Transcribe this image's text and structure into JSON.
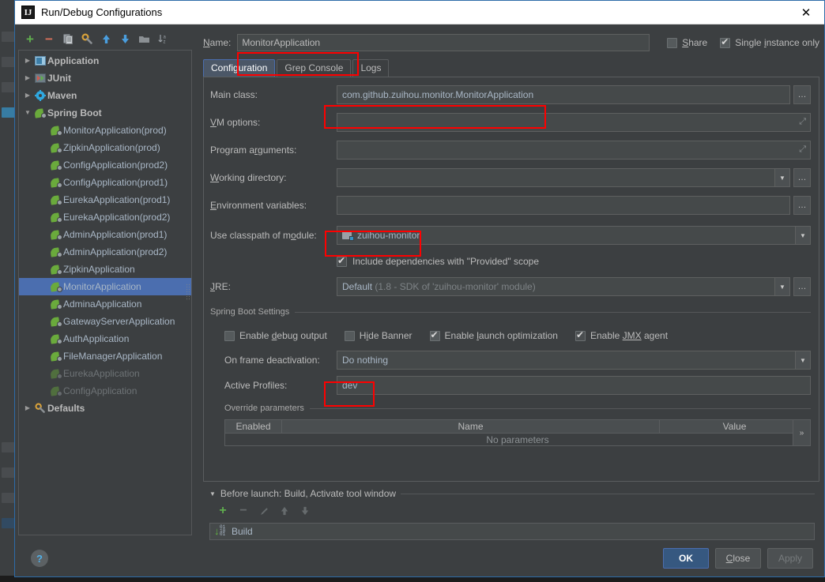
{
  "window": {
    "title": "Run/Debug Configurations",
    "icon": "intellij-idea-icon",
    "close_label": "✕"
  },
  "tree_toolbar": [
    {
      "name": "add-configuration-button",
      "glyph": "+",
      "color": "#5fad4e"
    },
    {
      "name": "remove-configuration-button",
      "glyph": "−",
      "color": "#d9705a"
    },
    {
      "name": "copy-configuration-button",
      "glyph": "copy-icon",
      "color": "#9aa0a6"
    },
    {
      "name": "edit-defaults-button",
      "glyph": "wrench-icon",
      "color": "#d9a23a"
    },
    {
      "name": "move-up-button",
      "glyph": "▲",
      "color": "#4a9ede"
    },
    {
      "name": "move-down-button",
      "glyph": "▼",
      "color": "#4a9ede"
    },
    {
      "name": "create-folder-button",
      "glyph": "folder-icon",
      "color": "#8b9094"
    },
    {
      "name": "sort-configurations-button",
      "glyph": "sort-az-icon",
      "color": "#9aa0a6"
    }
  ],
  "tree": {
    "groups": [
      {
        "label": "Application",
        "expanded": false,
        "icon": "application-icon"
      },
      {
        "label": "JUnit",
        "expanded": false,
        "icon": "junit-icon"
      },
      {
        "label": "Maven",
        "expanded": false,
        "icon": "maven-icon"
      },
      {
        "label": "Spring Boot",
        "expanded": true,
        "icon": "spring-boot-icon"
      }
    ],
    "spring_boot_children": [
      {
        "label": "MonitorApplication(prod)",
        "selected": false,
        "dim": false
      },
      {
        "label": "ZipkinApplication(prod)",
        "selected": false,
        "dim": false
      },
      {
        "label": "ConfigApplication(prod2)",
        "selected": false,
        "dim": false
      },
      {
        "label": "ConfigApplication(prod1)",
        "selected": false,
        "dim": false
      },
      {
        "label": "EurekaApplication(prod1)",
        "selected": false,
        "dim": false
      },
      {
        "label": "EurekaApplication(prod2)",
        "selected": false,
        "dim": false
      },
      {
        "label": "AdminApplication(prod1)",
        "selected": false,
        "dim": false
      },
      {
        "label": "AdminApplication(prod2)",
        "selected": false,
        "dim": false
      },
      {
        "label": "ZipkinApplication",
        "selected": false,
        "dim": false
      },
      {
        "label": "MonitorApplication",
        "selected": true,
        "dim": false
      },
      {
        "label": "AdminaApplication",
        "selected": false,
        "dim": false
      },
      {
        "label": "GatewayServerApplication",
        "selected": false,
        "dim": false
      },
      {
        "label": "AuthApplication",
        "selected": false,
        "dim": false
      },
      {
        "label": "FileManagerApplication",
        "selected": false,
        "dim": false
      },
      {
        "label": "EurekaApplication",
        "selected": false,
        "dim": true
      },
      {
        "label": "ConfigApplication",
        "selected": false,
        "dim": true
      }
    ],
    "defaults": {
      "label": "Defaults",
      "expanded": false,
      "icon": "wrench-icon"
    }
  },
  "name_row": {
    "label": "Name:",
    "value": "MonitorApplication",
    "share": {
      "label": "Share",
      "checked": false
    },
    "single_instance": {
      "label": "Single instance only",
      "checked": true
    }
  },
  "tabs": [
    {
      "label": "Configuration",
      "active": true
    },
    {
      "label": "Grep Console",
      "active": false
    },
    {
      "label": "Logs",
      "active": false
    }
  ],
  "configuration": {
    "main_class": {
      "label": "Main class:",
      "value": "com.github.zuihou.monitor.MonitorApplication",
      "browse": "…"
    },
    "vm_options": {
      "label": "VM options:",
      "value": "",
      "expand": "⤢"
    },
    "program_arguments": {
      "label": "Program arguments:",
      "value": "",
      "expand": "⤢"
    },
    "working_directory": {
      "label": "Working directory:",
      "value": "",
      "browse": "…"
    },
    "environment_variables": {
      "label": "Environment variables:",
      "value": "",
      "browse": "…"
    },
    "use_classpath_of_module": {
      "label": "Use classpath of module:",
      "value": "zuihou-monitor",
      "icon": "module-icon"
    },
    "include_provided": {
      "label": "Include dependencies with \"Provided\" scope",
      "checked": true
    },
    "jre": {
      "label": "JRE:",
      "value": "Default",
      "value_hint": "(1.8 - SDK of 'zuihou-monitor' module)",
      "browse": "…"
    }
  },
  "spring_boot_settings": {
    "group_title": "Spring Boot Settings",
    "checkboxes": [
      {
        "label": "Enable debug output",
        "checked": false
      },
      {
        "label": "Hide Banner",
        "checked": false
      },
      {
        "label": "Enable launch optimization",
        "checked": true
      },
      {
        "label": "Enable JMX agent",
        "checked": true
      }
    ],
    "on_frame_deactivation": {
      "label": "On frame deactivation:",
      "value": "Do nothing"
    },
    "active_profiles": {
      "label": "Active Profiles:",
      "value": "dev"
    },
    "override_parameters": {
      "group_title": "Override parameters",
      "columns": [
        "Enabled",
        "Name",
        "Value"
      ],
      "rows": [],
      "empty_text": "No parameters",
      "more_button": "»"
    }
  },
  "before_launch": {
    "title": "Before launch: Build, Activate tool window",
    "toolbar": [
      {
        "name": "add-task-button",
        "glyph": "+",
        "enabled": true
      },
      {
        "name": "remove-task-button",
        "glyph": "−",
        "enabled": false
      },
      {
        "name": "edit-task-button",
        "glyph": "✎",
        "enabled": false
      },
      {
        "name": "move-task-up-button",
        "glyph": "▲",
        "enabled": false
      },
      {
        "name": "move-task-down-button",
        "glyph": "▼",
        "enabled": false
      }
    ],
    "tasks": [
      {
        "label": "Build",
        "icon": "build-icon"
      }
    ]
  },
  "footer": {
    "help": "?",
    "ok": "OK",
    "close": "Close",
    "apply": "Apply"
  },
  "colors": {
    "accent_blue": "#4b6eaf",
    "selection": "#4b6eaf",
    "annotation_red": "#ff0000",
    "spring_green": "#6aaa3c",
    "panel_bg": "#3c3f41",
    "field_bg": "#45494a"
  }
}
